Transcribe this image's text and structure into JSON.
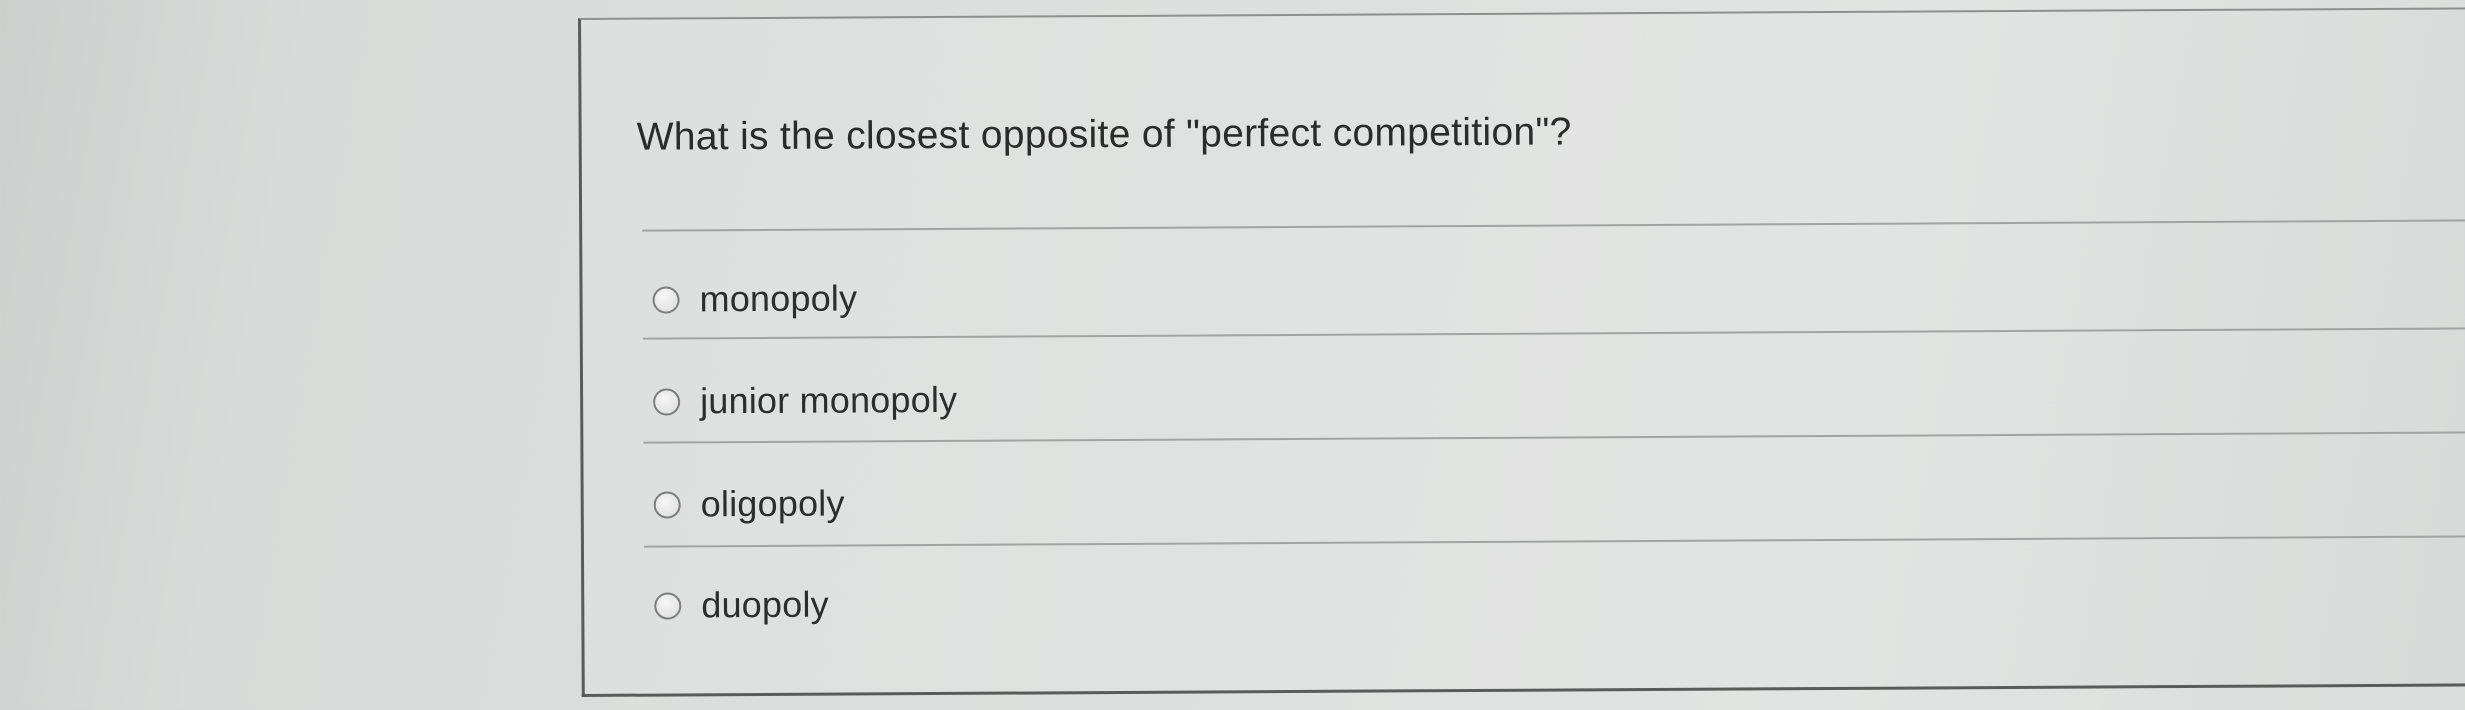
{
  "question": {
    "text": "What is the closest opposite of \"perfect competition\"?"
  },
  "options": [
    {
      "label": "monopoly",
      "selected": false
    },
    {
      "label": "junior monopoly",
      "selected": false
    },
    {
      "label": "oligopoly",
      "selected": false
    },
    {
      "label": "duopoly",
      "selected": false
    }
  ]
}
